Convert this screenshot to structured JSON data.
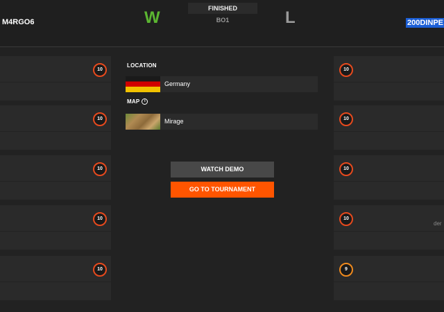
{
  "header": {
    "team_left": "M4RGO6",
    "team_right": "200DINPE",
    "result_left": "W",
    "result_right": "L",
    "status": "FINISHED",
    "format": "BO1"
  },
  "left_players": [
    {
      "level": "10"
    },
    {
      "level": "10"
    },
    {
      "level": "10"
    },
    {
      "level": "10"
    },
    {
      "level": "10"
    }
  ],
  "right_players": [
    {
      "level": "10"
    },
    {
      "level": "10"
    },
    {
      "level": "10"
    },
    {
      "level": "10"
    },
    {
      "level": "9"
    }
  ],
  "right_cut_text": "der",
  "location": {
    "label": "LOCATION",
    "value": "Germany",
    "flag_icon": "germany-flag-icon"
  },
  "map": {
    "label": "MAP",
    "info_symbol": "i",
    "value": "Mirage"
  },
  "buttons": {
    "watch_demo": "WATCH DEMO",
    "go_to_tournament": "GO TO TOURNAMENT"
  },
  "colors": {
    "win": "#5bb531",
    "accent": "#ff5500",
    "level_10": "#e84a1d",
    "level_9": "#f08a1d"
  }
}
